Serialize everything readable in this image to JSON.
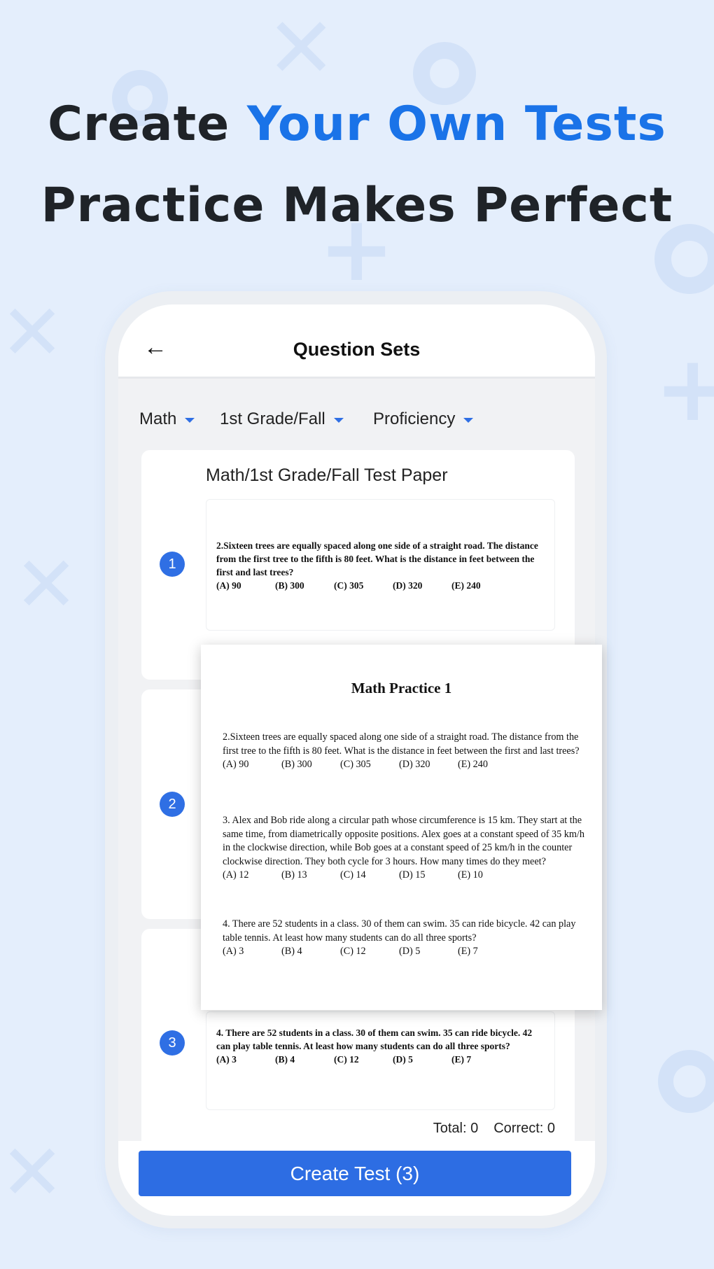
{
  "headline": {
    "line1_prefix": "Create ",
    "line1_accent": "Your Own Tests",
    "line2": "Practice Makes Perfect"
  },
  "colors": {
    "accent": "#1a73e8",
    "button": "#2d6de3",
    "badge": "#2f6fe4",
    "background": "#e4eefc"
  },
  "header": {
    "back_icon": "arrow-left-icon",
    "title": "Question Sets"
  },
  "filters": [
    {
      "label": "Math"
    },
    {
      "label": "1st Grade/Fall"
    },
    {
      "label": "Proficiency"
    }
  ],
  "cards": [
    {
      "number": "1",
      "title": "Math/1st Grade/Fall Test Paper",
      "question": "2.Sixteen trees are equally spaced along one side of a straight  road. The distance from the first tree to the fifth is 80 feet. What is the distance in feet between the first and last trees?",
      "options": [
        "(A) 90",
        "(B) 300",
        "(C) 305",
        "(D) 320",
        "(E) 240"
      ]
    },
    {
      "number": "2"
    },
    {
      "number": "3",
      "question": "4. There are 52 students in a class. 30 of them can swim. 35 can ride bicycle. 42 can play table tennis. At least how many students can do all three sports?",
      "options": [
        "(A) 3",
        "(B) 4",
        "(C) 12",
        "(D) 5",
        "(E) 7"
      ]
    }
  ],
  "totals": {
    "total": "Total: 0",
    "correct": "Correct: 0"
  },
  "create_button": "Create Test (3)",
  "popup": {
    "title": "Math Practice 1",
    "questions": [
      {
        "text": "2.Sixteen trees are equally spaced along one side of a straight  road. The distance from the first tree to the fifth is 80 feet. What is the distance in feet between the first and last trees?",
        "options": [
          "(A) 90",
          "(B) 300",
          "(C) 305",
          "(D) 320",
          "(E) 240"
        ]
      },
      {
        "text": "3.  Alex and Bob ride along a circular path whose circumference is 15 km. They start at the same time, from diametrically opposite positions. Alex goes at a constant speed of 35 km/h in the clockwise direction, while Bob goes at a constant speed of 25 km/h in the counter clockwise direction. They both cycle for 3 hours. How many times do they meet?",
        "options": [
          "(A) 12",
          "(B) 13",
          "(C) 14",
          "(D) 15",
          "(E) 10"
        ]
      },
      {
        "text": "4.  There are 52 students in a class. 30 of them can swim. 35 can ride bicycle. 42 can play table tennis. At least how many students can do all three sports?",
        "options": [
          "(A) 3",
          "(B) 4",
          "(C) 12",
          "(D) 5",
          "(E) 7"
        ]
      }
    ]
  }
}
